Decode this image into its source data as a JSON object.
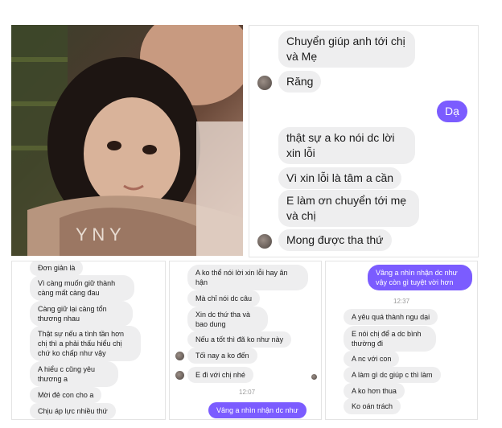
{
  "top_text": "",
  "panel_top_right": {
    "messages": [
      {
        "dir": "in",
        "text": "Chuyển giúp anh tới chị và Mẹ"
      },
      {
        "dir": "in",
        "text": "Răng"
      },
      {
        "dir": "out",
        "text": "Dạ"
      },
      {
        "dir": "in",
        "text": "thật sự a ko nói dc lời xin lỗi"
      },
      {
        "dir": "in",
        "text": "Vì xin lỗi là tâm a cần"
      },
      {
        "dir": "in",
        "text": "E làm ơn chuyển tới mẹ và chị"
      },
      {
        "dir": "in",
        "text": "Mong được tha thứ"
      }
    ]
  },
  "panel_bottom_left": {
    "messages": [
      {
        "dir": "in",
        "text": "Đơn giản là"
      },
      {
        "dir": "in",
        "text": "Vì càng muốn giữ thành càng mất càng đau"
      },
      {
        "dir": "in",
        "text": "Càng giữ lại càng tổn thương nhau"
      },
      {
        "dir": "in",
        "text": "Thật sự nếu a tình tần hơn chị thì a phải thấu hiểu chị chứ ko chấp như vậy"
      },
      {
        "dir": "in",
        "text": "A hiểu c cũng yêu thương a"
      },
      {
        "dir": "in",
        "text": "Mời đẻ con cho a"
      },
      {
        "dir": "in",
        "text": "Chịu áp lực nhiều thứ"
      }
    ]
  },
  "panel_bottom_middle": {
    "messages": [
      {
        "dir": "in",
        "text": "A ko thể nói lời xin lỗi hay ân hận"
      },
      {
        "dir": "in",
        "text": "Mà chỉ nói dc câu"
      },
      {
        "dir": "in",
        "text": "Xin dc thứ tha và bao dung"
      },
      {
        "dir": "in",
        "text": "Nếu a tốt thì đã ko như này"
      },
      {
        "dir": "in",
        "text": "Tối nay a ko đến"
      },
      {
        "dir": "in",
        "text": "E đi với chị nhé"
      },
      {
        "dir": "time",
        "text": "12:07"
      },
      {
        "dir": "out",
        "text": "Vâng a nhìn nhận dc như"
      }
    ]
  },
  "panel_bottom_right": {
    "messages": [
      {
        "dir": "out",
        "text": "Vâng a nhìn nhận dc như vậy còn gì tuyệt vời hơn"
      },
      {
        "dir": "time",
        "text": "12:37"
      },
      {
        "dir": "in",
        "text": "A yêu quá thành ngu dại"
      },
      {
        "dir": "in",
        "text": "E nói chị để a dc bình thường đi"
      },
      {
        "dir": "in",
        "text": "A nc với con"
      },
      {
        "dir": "in",
        "text": "A làm gì dc giúp c thì làm"
      },
      {
        "dir": "in",
        "text": "A ko hơn thua"
      },
      {
        "dir": "in",
        "text": "Ko oán trách"
      }
    ]
  },
  "colors": {
    "outgoing": "#7b5cff",
    "incoming": "#eeeeef",
    "timestamp": "#9a9a9a"
  }
}
